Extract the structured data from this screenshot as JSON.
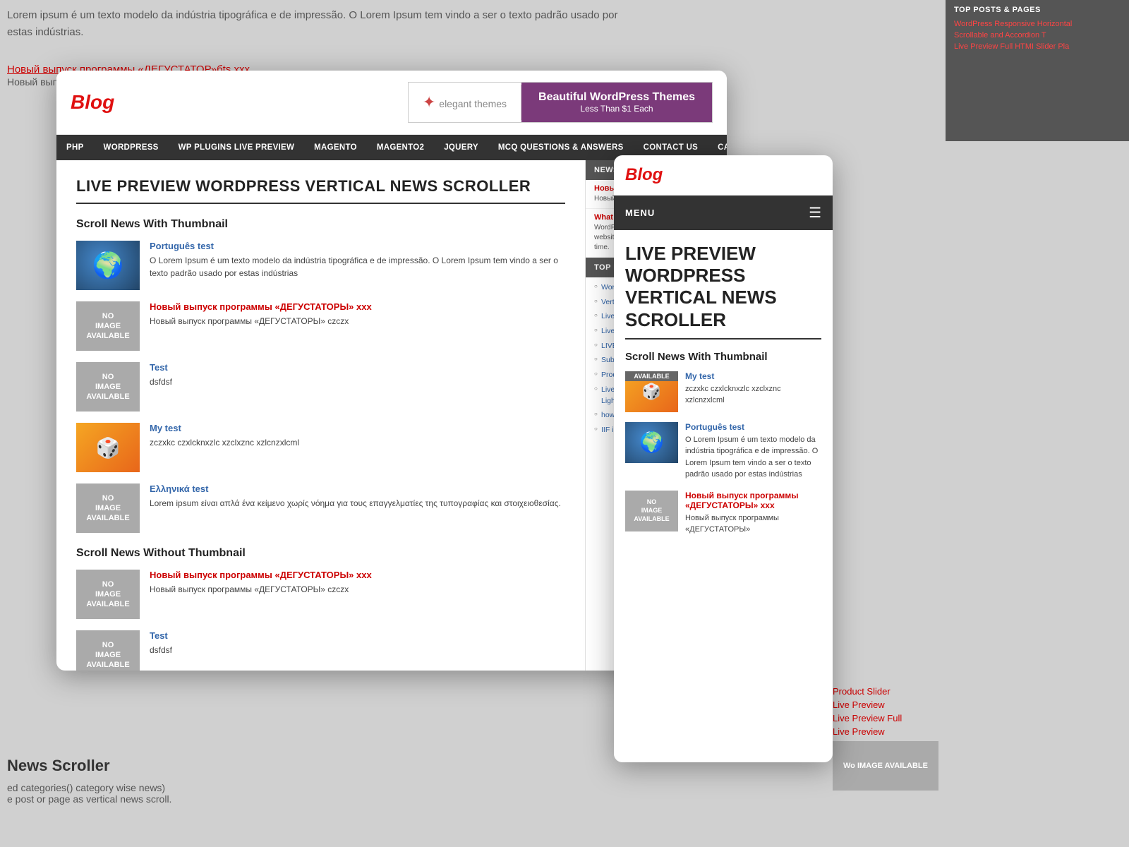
{
  "background": {
    "top_text": "Lorem ipsum é um texto modelo da indústria tipográfica e de impressão. O Lorem Ipsum tem vindo a ser o texto padrão usado por estas indústrias.",
    "bg_link1": "Новый выпуск программы «ДЕГУСТАТОР»бts xxx",
    "bg_link2": "Новый выпуск программы",
    "bottom_text1": "ed categories() category wise news)",
    "bottom_text2": "e post or page as vertical news scroll.",
    "bottom_section": "News Scroller"
  },
  "right_sidebar_bg": {
    "title": "TOP POSTS & PAGES",
    "links": [
      "WordPress Responsive Horizontal",
      "Scrollable and Accordion T",
      "Live Preview Full HTMI Slider Pla"
    ]
  },
  "large_window": {
    "logo": "Blog",
    "banner": {
      "logo_text": "elegant themes",
      "tagline": "Beautiful WordPress Themes",
      "subtitle": "Less Than $1 Each"
    },
    "nav": {
      "items": [
        "PHP",
        "WORDPRESS",
        "WP PLUGINS LIVE PREVIEW",
        "MAGENTO",
        "MAGENTO2",
        "JQUERY",
        "MCQ QUESTIONS & ANSWERS",
        "CONTACT US",
        "CART"
      ]
    },
    "sidebar": {
      "news_preview_title": "NEWS PREVIEW",
      "news_items": [
        {
          "link": "Новый выпуск пр...",
          "link_color": "red",
          "text": "Новый выпуск програм..."
        },
        {
          "link": "What is WordPress...",
          "link_color": "red",
          "text": "WordPress is web soft... beautiful website or... WordPress is both fre... time."
        }
      ],
      "top_posts_title": "TOP POSTS & PAGES",
      "top_posts": [
        "WordPress Resp...",
        "Vertical, Scrollable...",
        "Live Preview Wo...",
        "Live Preview Full",
        "LIVE PREVIEW W...",
        "Subscription Plugi...",
        "Product Slider F...",
        "Live Preview Wo... slider with Lightbo...",
        "how to get goog... checkbox keys",
        "IIF in php"
      ]
    },
    "main": {
      "title": "LIVE PREVIEW WORDPRESS VERTICAL NEWS SCROLLER",
      "section1_title": "Scroll News With Thumbnail",
      "news_items": [
        {
          "type": "globe",
          "link": "Português test",
          "link_color": "blue",
          "text": "O Lorem Ipsum é um texto modelo da indústria tipográfica e de impressão. O Lorem Ipsum tem vindo a ser o texto padrão usado por estas indústrias"
        },
        {
          "type": "no-image",
          "link": "Новый выпуск программы «ДЕГУСТАТОРЫ» xxx",
          "link_color": "red",
          "text": "Новый выпуск программы «ДЕГУСТАТОРЫ» czczx"
        },
        {
          "type": "no-image",
          "link": "Test",
          "link_color": "blue",
          "text": "dsfdsf"
        },
        {
          "type": "cube",
          "link": "My test",
          "link_color": "blue",
          "text": "zczxkc czxlcknxzlc xzclxznc xzlcnzxlcml"
        },
        {
          "type": "no-image",
          "link": "Ελληνικά test",
          "link_color": "blue",
          "text": "Lorem ipsum είναι απλά ένα κείμενο χωρίς νόημα για τους επαγγελματίες της τυπογραφίας και στοιχειοθεσίας."
        }
      ],
      "section2_title": "Scroll News Without Thumbnail",
      "news_items2": [
        {
          "type": "no-image",
          "link": "Новый выпуск программы «ДЕГУСТАТОРЫ» xxx",
          "link_color": "red",
          "text": "Новый выпуск программы «ДЕГУСТАТОРЫ» czczx"
        },
        {
          "type": "no-image",
          "link": "Test",
          "link_color": "blue",
          "text": "dsfdsf"
        }
      ]
    }
  },
  "mobile_window": {
    "logo": "Blog",
    "nav_label": "MENU",
    "main": {
      "title": "LIVE PREVIEW WORDPRESS VERTICAL NEWS SCROLLER",
      "section1_title": "Scroll News With Thumbnail",
      "news_items": [
        {
          "type": "no-image-available",
          "label": "AVAILABLE",
          "link": "My test",
          "link_color": "blue",
          "text": "zczxkc czxlcknxzlc xzclxznc xzlcnzxlcml"
        },
        {
          "type": "globe",
          "link": "Português test",
          "link_color": "blue",
          "text": "O Lorem Ipsum é um texto modelo da indústria tipográfica e de impressão. O Lorem Ipsum tem vindo a ser o texto padrão usado por estas indústrias"
        },
        {
          "type": "no-image",
          "link": "Новый выпуск программы «ДЕГУСТАТОРЫ» xxx",
          "link_color": "red",
          "text": "Новый выпуск программы «ДЕГУСТАТОРЫ»"
        }
      ]
    }
  },
  "bottom_right_items": {
    "items": [
      "Product Slider",
      "Live Preview",
      "Live Preview Full",
      "Live Preview",
      "Wo IMAGE AVAILABLE"
    ]
  }
}
